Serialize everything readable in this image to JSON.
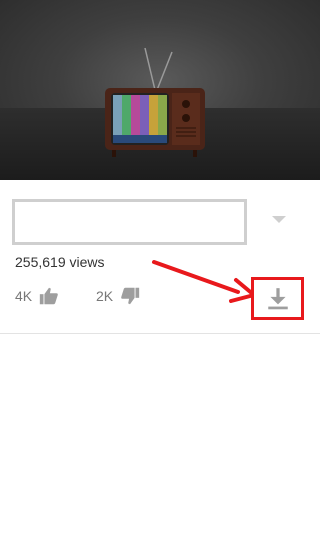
{
  "video": {
    "thumbnail_icon": "retro-tv-test-pattern"
  },
  "title": {
    "text": ""
  },
  "stats": {
    "views": "255,619 views",
    "likes": "4K",
    "dislikes": "2K"
  },
  "icons": {
    "like": "thumbs-up-icon",
    "dislike": "thumbs-down-icon",
    "download": "download-icon",
    "expand": "chevron-down-icon"
  },
  "colors": {
    "annotation": "#e8191c",
    "icon_gray": "#9e9e9e"
  }
}
